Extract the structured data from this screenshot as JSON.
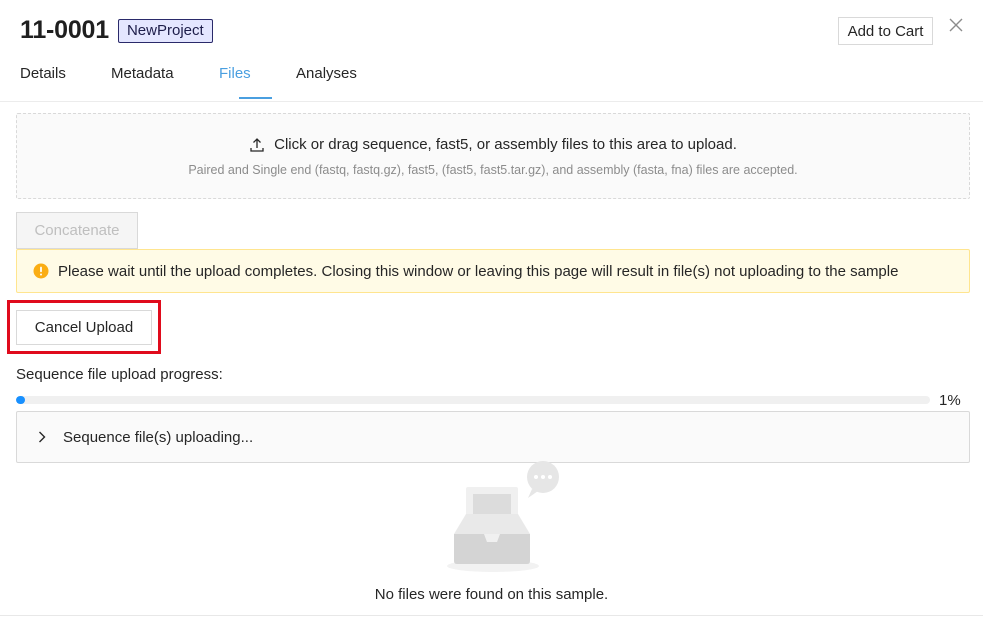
{
  "header": {
    "title": "11-0001",
    "project_tag": "NewProject",
    "add_to_cart_label": "Add to Cart"
  },
  "tabs": [
    {
      "label": "Details",
      "active": false
    },
    {
      "label": "Metadata",
      "active": false
    },
    {
      "label": "Files",
      "active": true
    },
    {
      "label": "Analyses",
      "active": false
    }
  ],
  "upload": {
    "dropzone_text": "Click or drag sequence, fast5, or assembly files to this area to upload.",
    "dropzone_hint": "Paired and Single end (fastq, fastq.gz), fast5, (fast5, fast5.tar.gz), and assembly (fasta, fna) files are accepted.",
    "concatenate_label": "Concatenate",
    "warning_text": "Please wait until the upload completes. Closing this window or leaving this page will result in file(s) not uploading to the sample",
    "cancel_label": "Cancel Upload",
    "progress_label": "Sequence file upload progress:",
    "progress_percent": 1,
    "progress_text": "1%",
    "collapse_label": "Sequence file(s) uploading..."
  },
  "empty": {
    "text": "No files were found on this sample."
  },
  "icons": {
    "upload": "upload-icon",
    "warning": "warning-icon",
    "close": "close-icon",
    "chevron": "chevron-right-icon",
    "empty": "empty-inbox-icon"
  },
  "colors": {
    "accent": "#4a9fe0",
    "progress": "#1890ff",
    "warning": "#faad14",
    "highlight": "#e00b1c"
  }
}
